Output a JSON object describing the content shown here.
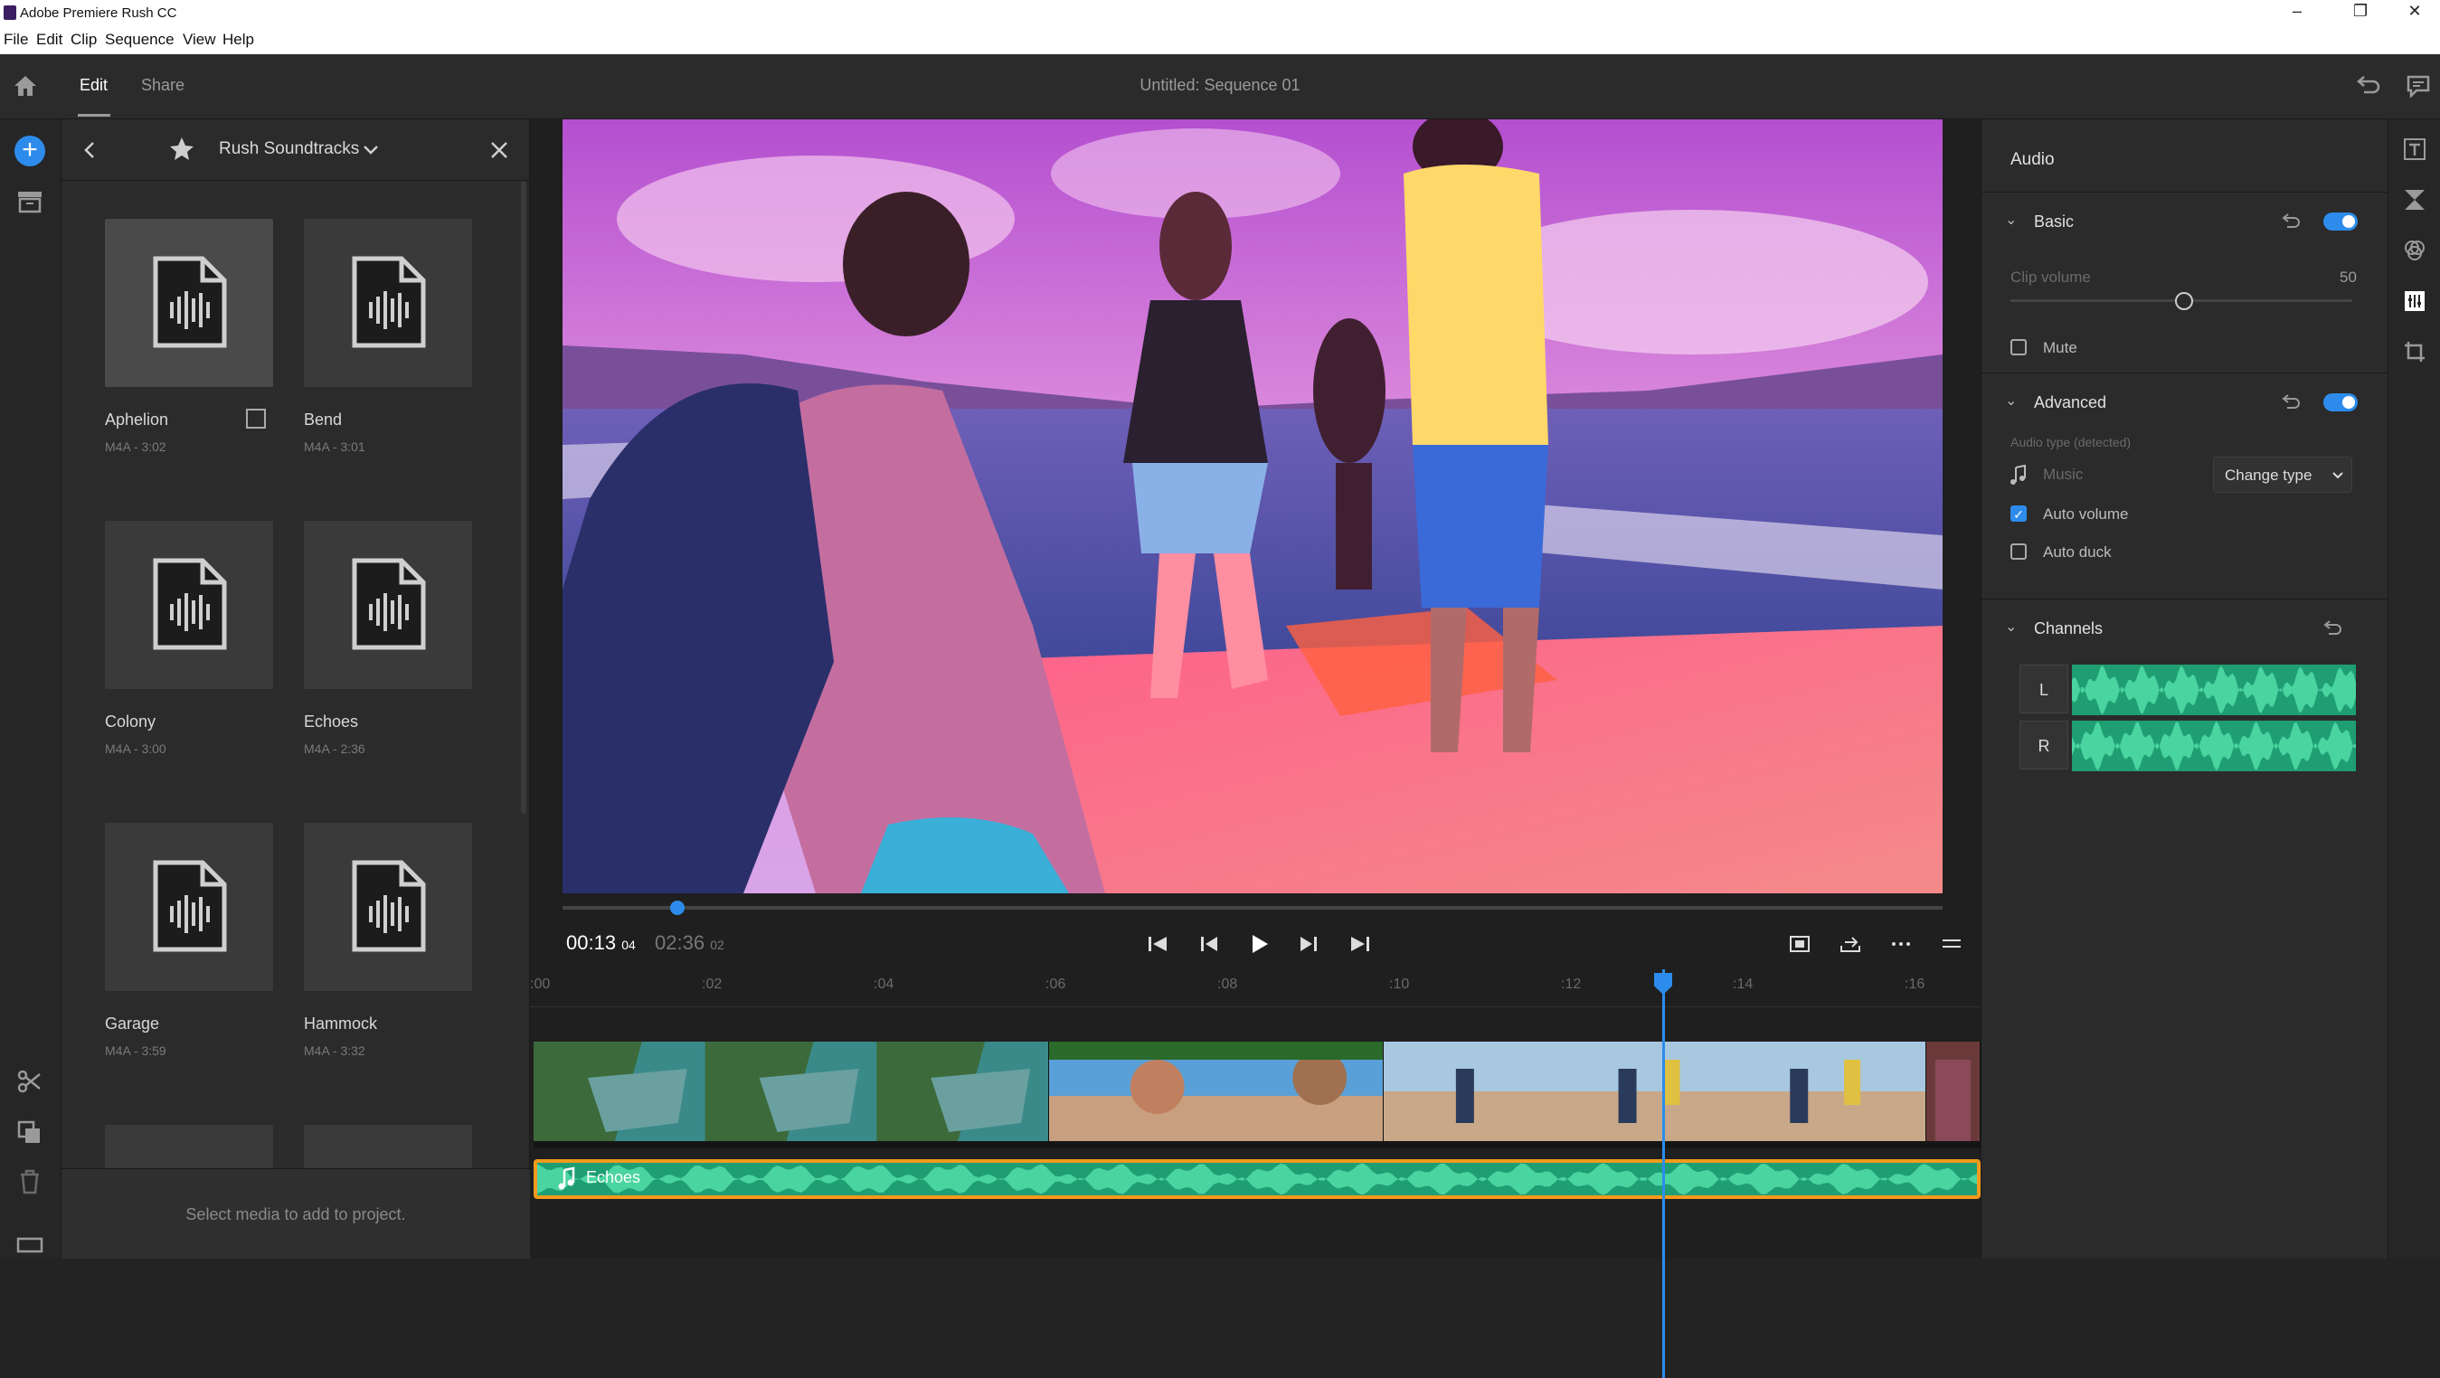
{
  "window": {
    "title": "Adobe Premiere Rush CC",
    "controls": [
      "–",
      "❐",
      "✕"
    ]
  },
  "menu": [
    "File",
    "Edit",
    "Clip",
    "Sequence",
    "View",
    "Help"
  ],
  "appbar": {
    "tabs": [
      "Edit",
      "Share"
    ],
    "active_tab": "Edit",
    "sequence_title": "Untitled: Sequence 01"
  },
  "media_panel": {
    "title": "Rush Soundtracks",
    "tracks": [
      {
        "name": "Aphelion",
        "meta": "M4A - 3:02"
      },
      {
        "name": "Bend",
        "meta": "M4A - 3:01"
      },
      {
        "name": "Colony",
        "meta": "M4A - 3:00"
      },
      {
        "name": "Echoes",
        "meta": "M4A - 2:36"
      },
      {
        "name": "Garage",
        "meta": "M4A - 3:59"
      },
      {
        "name": "Hammock",
        "meta": "M4A - 3:32"
      }
    ],
    "footer": "Select media to add to project."
  },
  "player": {
    "timecode_current": "00:13",
    "timecode_current_frames": "04",
    "timecode_total": "02:36",
    "timecode_total_frames": "02",
    "playhead_progress": 0.083
  },
  "timeline": {
    "ruler": [
      ":00",
      ":02",
      ":04",
      ":06",
      ":08",
      ":10",
      ":12",
      ":14",
      ":16"
    ],
    "audio_clip": "Echoes"
  },
  "audio_panel": {
    "title": "Audio",
    "basic": {
      "title": "Basic",
      "clip_volume_label": "Clip volume",
      "clip_volume_value": "50",
      "mute_label": "Mute"
    },
    "advanced": {
      "title": "Advanced",
      "audio_type_label": "Audio type (detected)",
      "type": "Music",
      "change_type": "Change type",
      "auto_volume": "Auto volume",
      "auto_duck": "Auto duck"
    },
    "channels": {
      "title": "Channels",
      "left": "L",
      "right": "R"
    }
  },
  "colors": {
    "accent": "#2d8ceb",
    "audio_clip": "#1f9e74",
    "audio_border": "#f29a1c"
  }
}
